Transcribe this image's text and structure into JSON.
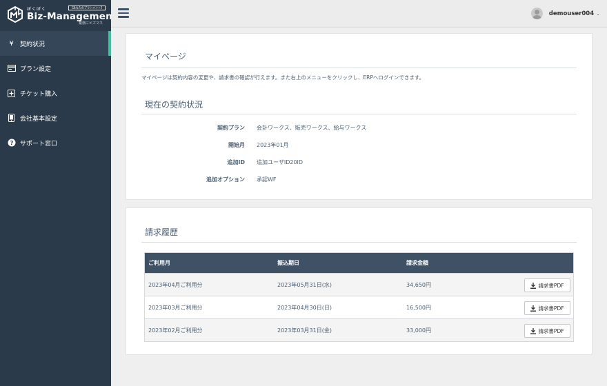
{
  "brand": {
    "kana": "ぼくぼく",
    "name": "Biz-Management",
    "tag": "【あなたのプランメント】",
    "sub": "業務にビズマネ"
  },
  "sidebar": {
    "items": [
      {
        "label": "契約状況",
        "icon": "yen-icon",
        "glyph": "¥"
      },
      {
        "label": "プラン設定",
        "icon": "card-icon"
      },
      {
        "label": "チケット購入",
        "icon": "plus-square-icon"
      },
      {
        "label": "会社基本設定",
        "icon": "tablet-icon"
      },
      {
        "label": "サポート窓口",
        "icon": "help-circle-icon",
        "glyph": "?"
      }
    ]
  },
  "header": {
    "username": "demouser004",
    "caret": "⌄"
  },
  "mypage": {
    "title": "マイページ",
    "description": "マイページは契約内容の変更や、請求書の確認が行えます。また右上のメニューをクリックし、ERPへログインできます。"
  },
  "contract": {
    "title": "現在の契約状況",
    "rows": [
      {
        "label": "契約プラン",
        "value": "会計ワークス、販売ワークス、給与ワークス"
      },
      {
        "label": "開始月",
        "value": "2023年01月"
      },
      {
        "label": "追加ID",
        "value": "追加ユーザID20ID"
      },
      {
        "label": "追加オプション",
        "value": "承認WF"
      }
    ]
  },
  "billing": {
    "title": "請求履歴",
    "columns": [
      "ご利用月",
      "振込期日",
      "請求金額"
    ],
    "rows": [
      {
        "month": "2023年04月ご利用分",
        "due": "2023年05月31日(水)",
        "amount": "34,650円",
        "button": "請求書PDF"
      },
      {
        "month": "2023年03月ご利用分",
        "due": "2023年04月30日(日)",
        "amount": "16,500円",
        "button": "請求書PDF"
      },
      {
        "month": "2023年02月ご利用分",
        "due": "2023年03月31日(金)",
        "amount": "33,000円",
        "button": "請求書PDF"
      }
    ]
  },
  "colors": {
    "sidebar": "#2b3a4a",
    "active_accent": "#3fbf9a",
    "table_header": "#3f5165"
  }
}
